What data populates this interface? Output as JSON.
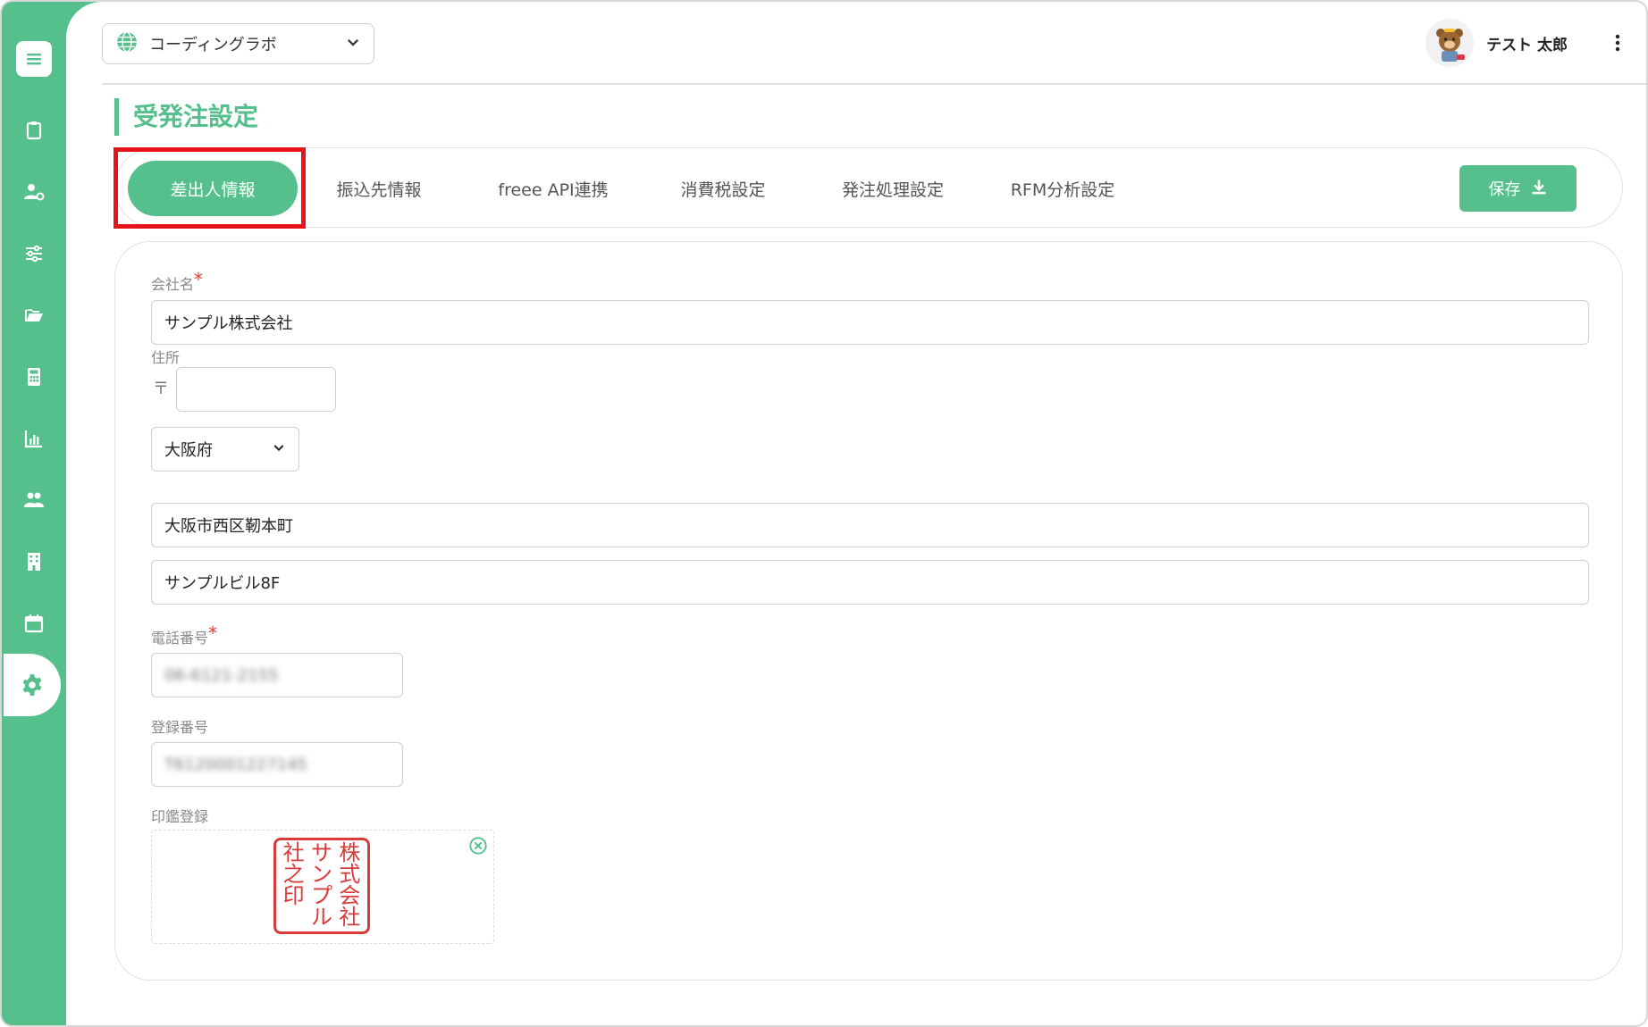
{
  "header": {
    "org_name": "コーディングラボ",
    "user_name": "テスト 太郎"
  },
  "page": {
    "title": "受発注設定"
  },
  "tabs": [
    {
      "label": "差出人情報",
      "active": true
    },
    {
      "label": "振込先情報",
      "active": false
    },
    {
      "label": "freee API連携",
      "active": false
    },
    {
      "label": "消費税設定",
      "active": false
    },
    {
      "label": "発注処理設定",
      "active": false
    },
    {
      "label": "RFM分析設定",
      "active": false
    }
  ],
  "toolbar": {
    "save_label": "保存"
  },
  "form": {
    "company": {
      "label": "会社名",
      "required_mark": "*",
      "value": "サンプル株式会社"
    },
    "address": {
      "label": "住所",
      "zip_mark": "〒",
      "zip_value": "",
      "prefecture": "大阪府",
      "line1": "大阪市西区靭本町",
      "line2": "サンプルビル8F"
    },
    "phone": {
      "label": "電話番号",
      "required_mark": "*",
      "value": "06-6121-2155"
    },
    "registration": {
      "label": "登録番号",
      "value": "T6120001227145"
    },
    "seal": {
      "label": "印鑑登録",
      "image_text": [
        "株式会社",
        "サンプル",
        "社之印"
      ]
    }
  },
  "icons": {
    "sidebar": [
      "menu-icon",
      "clipboard-icon",
      "user-gear-icon",
      "sliders-icon",
      "folder-open-icon",
      "calculator-icon",
      "bar-chart-icon",
      "users-icon",
      "building-icon",
      "calendar-icon",
      "gear-icon"
    ]
  },
  "colors": {
    "accent": "#55c08c",
    "required": "#e53935",
    "highlight": "#e8141c",
    "seal": "#d93a3a"
  }
}
